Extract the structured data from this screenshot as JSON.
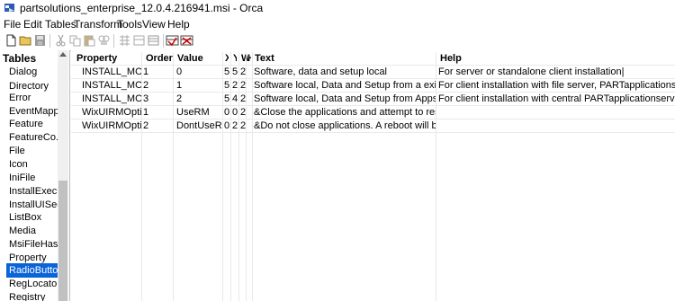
{
  "window": {
    "title": "partsolutions_enterprise_12.0.4.216941.msi - Orca"
  },
  "menu": [
    "File",
    "Edit",
    "Tables",
    "Transform",
    "Tools",
    "View",
    "Help"
  ],
  "toolbar": {
    "icons": [
      "new-file-icon",
      "open-folder-icon",
      "save-icon",
      "cut-icon",
      "copy-icon",
      "paste-icon",
      "find-icon",
      "add-row-icon",
      "drop-table-icon",
      "validate-icon",
      "adjust-schema-icon",
      "merge-module-icon"
    ]
  },
  "sidebar": {
    "header": "Tables",
    "items": [
      "Dialog",
      "Directory",
      "Error",
      "EventMappi...",
      "Feature",
      "FeatureCo...",
      "File",
      "Icon",
      "IniFile",
      "InstallExecu...",
      "InstallUISeq...",
      "ListBox",
      "Media",
      "MsiFileHash",
      "Property",
      "RadioButton",
      "RegLocator",
      "Registry"
    ],
    "selected": "RadioButton",
    "selection_color": "#0a64d8"
  },
  "grid": {
    "headers": [
      "Property",
      "Order",
      "Value",
      "X",
      "Y",
      "W",
      "H",
      "Text",
      "Help"
    ],
    "rows": [
      [
        "INSTALL_MODE",
        "1",
        "0",
        "5",
        "5",
        "2...",
        "",
        "Software, data and setup local",
        "For server or standalone client installation|"
      ],
      [
        "INSTALL_MODE",
        "2",
        "1",
        "5",
        "2",
        "2...",
        "",
        "Software local, Data and Setup from a existing server",
        "For client installation with file server, PARTapplicationserver optional|"
      ],
      [
        "INSTALL_MODE",
        "3",
        "2",
        "5",
        "4",
        "2...",
        "",
        "Software local, Data and Setup from Appserver",
        "For client installation with central PARTapplicationserver|"
      ],
      [
        "WixUIRMOption",
        "1",
        "UseRM",
        "0",
        "0",
        "2...",
        "",
        "&Close the applications and attempt to restart them.",
        ""
      ],
      [
        "WixUIRMOption",
        "2",
        "DontUseRM",
        "0",
        "2",
        "2...",
        "",
        "&Do not close applications. A reboot will be required.",
        ""
      ]
    ]
  }
}
